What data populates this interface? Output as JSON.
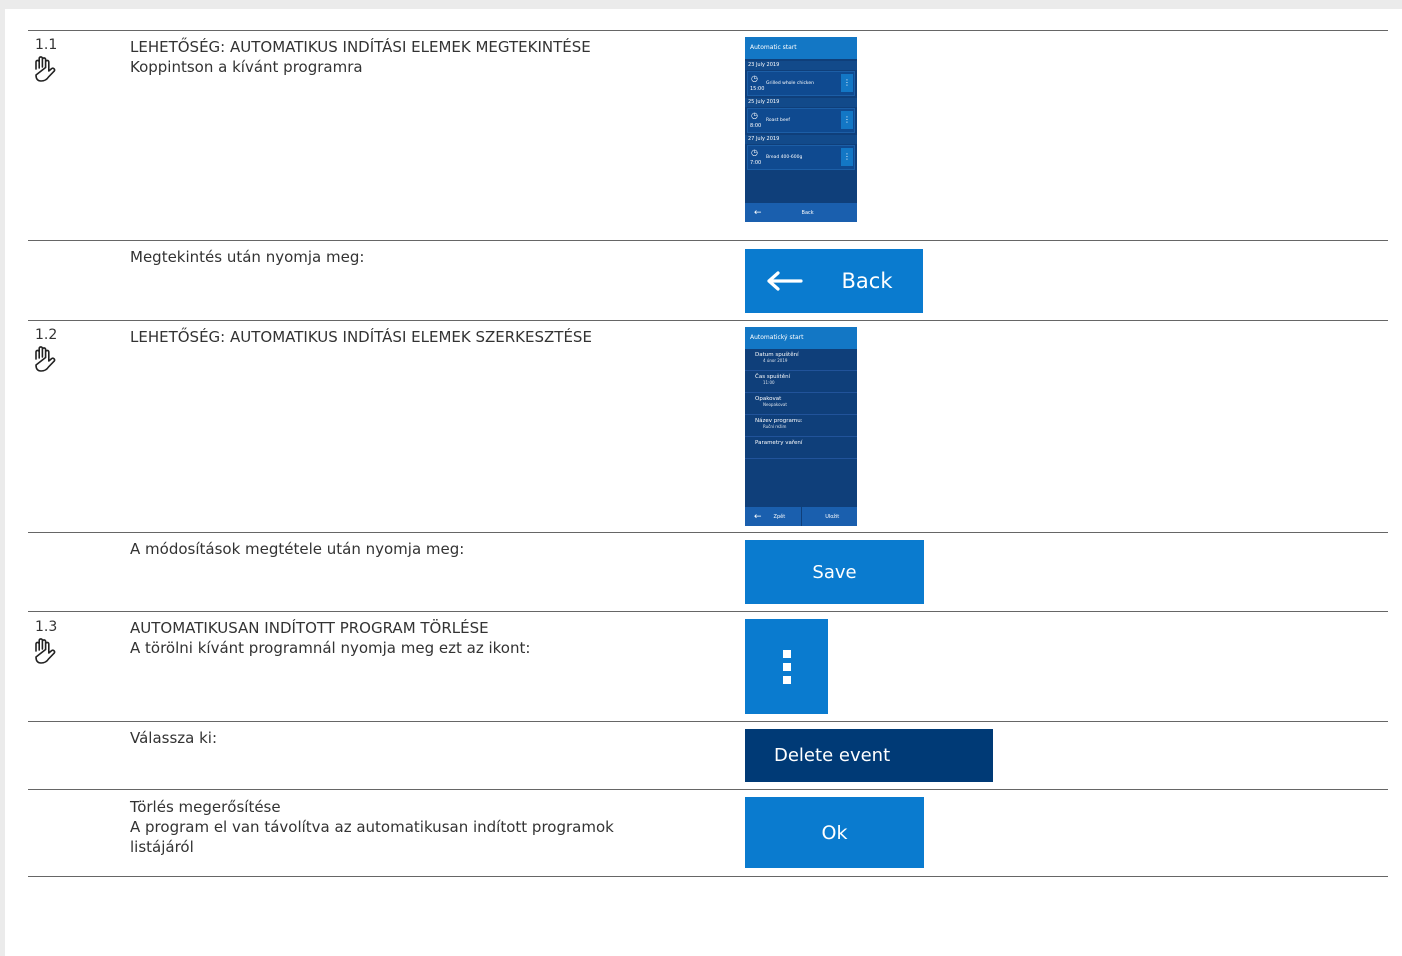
{
  "colors": {
    "accent": "#0a7bcf",
    "dark_button": "#003a76",
    "screen_bg": "#0f3f7a"
  },
  "sections": {
    "s1": {
      "number": "1.1",
      "heading": "LEHETŐSÉG: AUTOMATIKUS INDÍTÁSI ELEMEK MEGTEKINTÉSE",
      "instruction": "Koppintson a kívánt programra",
      "after_text": "Megtekintés után nyomja meg:",
      "button_label": "Back",
      "screen": {
        "title": "Automatic start",
        "groups": [
          {
            "date": "23 July 2019",
            "time": "15:00",
            "name": "Grilled whole chicken"
          },
          {
            "date": "25 July 2019",
            "time": "8:00",
            "name": "Roast beef"
          },
          {
            "date": "27 July 2019",
            "time": "7:00",
            "name": "Bread 400-600g"
          }
        ],
        "footer_label": "Back"
      }
    },
    "s2": {
      "number": "1.2",
      "heading": "LEHETŐSÉG: AUTOMATIKUS INDÍTÁSI ELEMEK SZERKESZTÉSE",
      "after_text": "A módosítások megtétele után nyomja meg:",
      "button_label": "Save",
      "screen": {
        "title": "Automatický start",
        "rows": [
          {
            "label": "Datum spuštění",
            "value": "4 únor 2019"
          },
          {
            "label": "Čas spuštění",
            "value": "11:00"
          },
          {
            "label": "Opakovat",
            "value": "Neopakovat"
          },
          {
            "label": "Název programu:",
            "value": "Ruční režim"
          },
          {
            "label": "Parametry vaření",
            "value": ""
          }
        ],
        "footer_back": "Zpět",
        "footer_save": "Uložit"
      }
    },
    "s3": {
      "number": "1.3",
      "heading": "AUTOMATIKUSAN INDÍTOTT PROGRAM TÖRLÉSE",
      "instruction": "A törölni kívánt programnál nyomja meg ezt az ikont:",
      "select_text": "Válassza ki:",
      "delete_label": "Delete event",
      "confirm_line1": "Törlés megerősítése",
      "confirm_line2": "A program el van távolítva az automatikusan indított programok",
      "confirm_line3": "listájáról",
      "ok_label": "Ok"
    }
  }
}
